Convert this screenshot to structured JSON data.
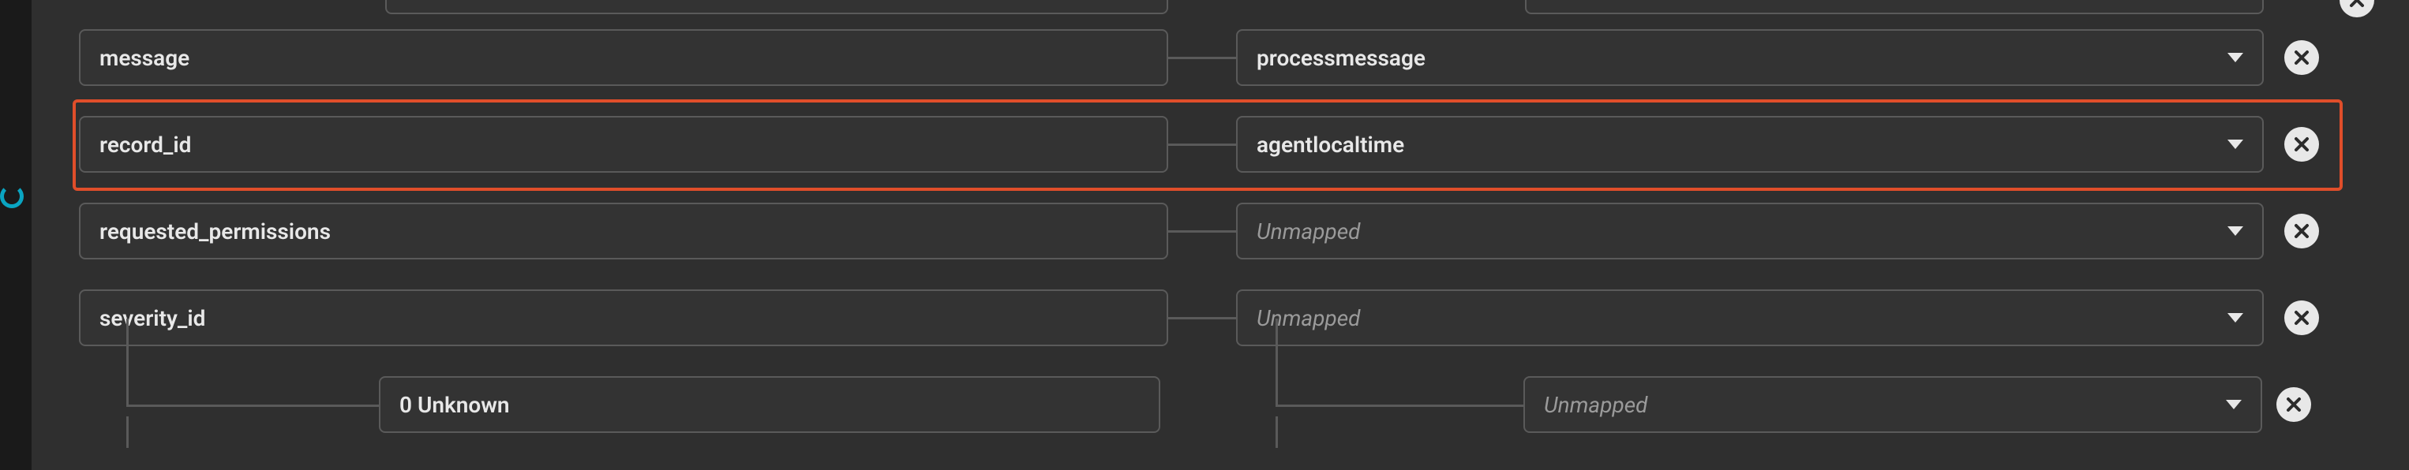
{
  "rows": [
    {
      "left": "message",
      "right": "processmessage",
      "right_placeholder": false
    },
    {
      "left": "record_id",
      "right": "agentlocaltime",
      "right_placeholder": false,
      "highlighted": true
    },
    {
      "left": "requested_permissions",
      "right": "Unmapped",
      "right_placeholder": true
    },
    {
      "left": "severity_id",
      "right": "Unmapped",
      "right_placeholder": true
    }
  ],
  "sub_row": {
    "left": "0 Unknown",
    "right": "Unmapped",
    "right_placeholder": true
  },
  "icons": {
    "delete_title": "Remove mapping"
  }
}
